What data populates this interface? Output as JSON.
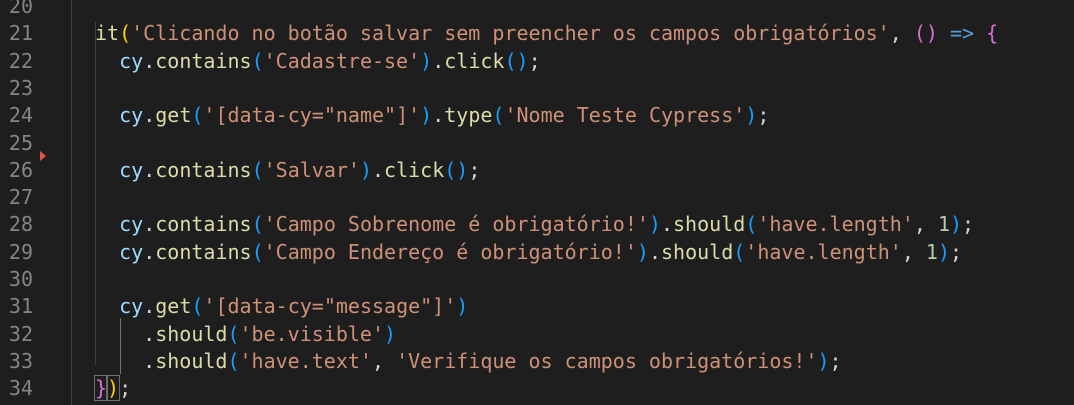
{
  "editor": {
    "line_numbers": [
      "20",
      "21",
      "22",
      "23",
      "24",
      "25",
      "26",
      "27",
      "28",
      "29",
      "30",
      "31",
      "32",
      "33",
      "34"
    ],
    "line21": {
      "it": "it",
      "test_title": "'Clicando no botão salvar sem preencher os campos obrigatórios'",
      "arrow": "=>"
    },
    "line22": {
      "cy": "cy",
      "contains": "contains",
      "arg": "'Cadastre-se'",
      "click": "click"
    },
    "line24": {
      "cy": "cy",
      "get": "get",
      "selector": "'[data-cy=\"name\"]'",
      "type": "type",
      "arg": "'Nome Teste Cypress'"
    },
    "line26": {
      "cy": "cy",
      "contains": "contains",
      "arg": "'Salvar'",
      "click": "click"
    },
    "line28": {
      "cy": "cy",
      "contains": "contains",
      "arg": "'Campo Sobrenome é obrigatório!'",
      "should": "should",
      "chainer": "'have.length'",
      "num": "1"
    },
    "line29": {
      "cy": "cy",
      "contains": "contains",
      "arg": "'Campo Endereço é obrigatório!'",
      "should": "should",
      "chainer": "'have.length'",
      "num": "1"
    },
    "line31": {
      "cy": "cy",
      "get": "get",
      "selector": "'[data-cy=\"message\"]'"
    },
    "line32": {
      "should": "should",
      "chainer": "'be.visible'"
    },
    "line33": {
      "should": "should",
      "chainer": "'have.text'",
      "text": "'Verifique os campos obrigatórios!'"
    }
  },
  "colors": {
    "background": "#1e1e1e",
    "function": "#dcdcaa",
    "variable": "#9cdcfe",
    "string": "#ce9178",
    "number": "#b5cea8",
    "keyword": "#569cd6",
    "bracket_level1": "#ffd700",
    "bracket_level2": "#da70d6",
    "bracket_level3": "#179fff",
    "breakpoint_marker": "#f14c4c"
  }
}
